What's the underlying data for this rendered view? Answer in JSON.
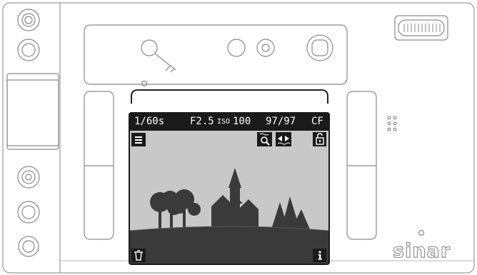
{
  "brand": "sinar",
  "status_bar": {
    "shutter": "1/60s",
    "aperture": "F2.5",
    "iso_label": "ISO",
    "iso_value": "100",
    "shots": "97/97",
    "card": "CF"
  },
  "icons": {
    "menu": "hamburger-menu-icon",
    "zoom": "magnifier-icon",
    "focus": "focus-arrows-icon",
    "lock": "lock-icon",
    "delete": "trash-icon",
    "info": "info-icon"
  },
  "colors": {
    "screen_bezel": "#1a1a1a",
    "screen_bg": "#c8c8c8",
    "silhouette": "#3a3a3a",
    "outline": "#8a8a8a"
  }
}
